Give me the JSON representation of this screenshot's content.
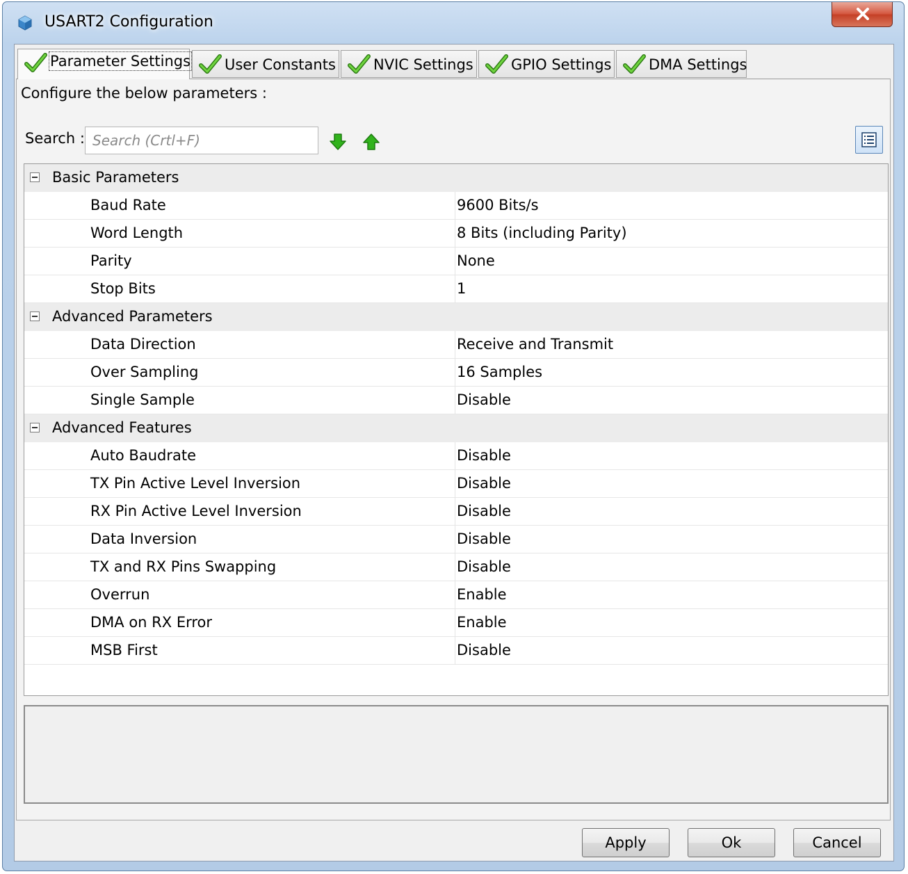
{
  "window": {
    "title": "USART2 Configuration"
  },
  "tabs": [
    {
      "label": "Parameter Settings"
    },
    {
      "label": "User Constants"
    },
    {
      "label": "NVIC Settings"
    },
    {
      "label": "GPIO Settings"
    },
    {
      "label": "DMA Settings"
    }
  ],
  "active_tab": "Parameter Settings",
  "panel": {
    "instruction": "Configure the below parameters :"
  },
  "search": {
    "label": "Search :",
    "placeholder": "Search (Crtl+F)",
    "value": ""
  },
  "groups": [
    {
      "title": "Basic Parameters",
      "params": [
        {
          "name": "Baud Rate",
          "value": "9600 Bits/s"
        },
        {
          "name": "Word Length",
          "value": "8 Bits (including Parity)"
        },
        {
          "name": "Parity",
          "value": "None"
        },
        {
          "name": "Stop Bits",
          "value": "1"
        }
      ]
    },
    {
      "title": "Advanced Parameters",
      "params": [
        {
          "name": "Data Direction",
          "value": "Receive and Transmit"
        },
        {
          "name": "Over Sampling",
          "value": "16 Samples"
        },
        {
          "name": "Single Sample",
          "value": "Disable"
        }
      ]
    },
    {
      "title": "Advanced Features",
      "params": [
        {
          "name": "Auto Baudrate",
          "value": "Disable"
        },
        {
          "name": "TX Pin Active Level Inversion",
          "value": "Disable"
        },
        {
          "name": "RX Pin Active Level Inversion",
          "value": "Disable"
        },
        {
          "name": "Data Inversion",
          "value": "Disable"
        },
        {
          "name": "TX and RX Pins Swapping",
          "value": "Disable"
        },
        {
          "name": "Overrun",
          "value": "Enable"
        },
        {
          "name": "DMA on RX Error",
          "value": "Enable"
        },
        {
          "name": "MSB First",
          "value": "Disable"
        }
      ]
    }
  ],
  "buttons": {
    "apply": "Apply",
    "ok": "Ok",
    "cancel": "Cancel"
  },
  "icons": {
    "title": "cube-app-icon",
    "close": "close-icon",
    "tab_status": "check-icon",
    "search_next": "arrow-down-icon",
    "search_prev": "arrow-up-icon",
    "view_toggle": "list-view-icon",
    "group_toggle": "collapse-icon"
  },
  "colors": {
    "check_green": "#3fae1e",
    "arrow_green": "#31b31c",
    "close_red": "#c9462b"
  }
}
